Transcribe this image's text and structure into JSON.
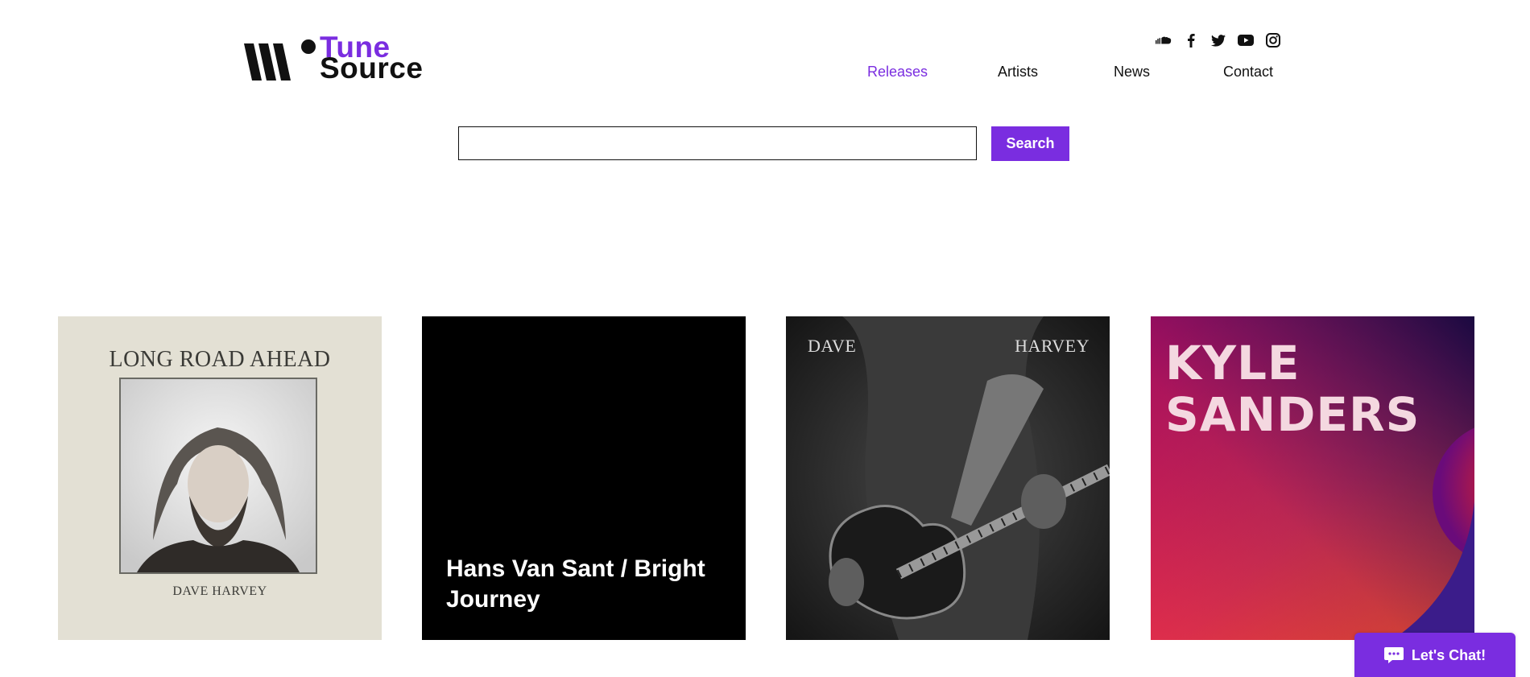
{
  "brand": {
    "tune": "Tune",
    "source": "Source",
    "accent_color": "#7a2de0"
  },
  "social": [
    "soundcloud-icon",
    "facebook-icon",
    "twitter-icon",
    "youtube-icon",
    "instagram-icon"
  ],
  "nav": {
    "items": [
      {
        "label": "Releases",
        "active": true
      },
      {
        "label": "Artists",
        "active": false
      },
      {
        "label": "News",
        "active": false
      },
      {
        "label": "Contact",
        "active": false
      }
    ]
  },
  "search": {
    "value": "",
    "placeholder": "",
    "button_label": "Search"
  },
  "releases": [
    {
      "title": "LONG ROAD AHEAD",
      "artist": "DAVE HARVEY"
    },
    {
      "title": "Hans Van Sant / Bright Journey"
    },
    {
      "left_text": "DAVE",
      "right_text": "HARVEY"
    },
    {
      "line1": "KYLE",
      "line2": "SANDERS"
    }
  ],
  "chat": {
    "label": "Let's Chat!"
  }
}
